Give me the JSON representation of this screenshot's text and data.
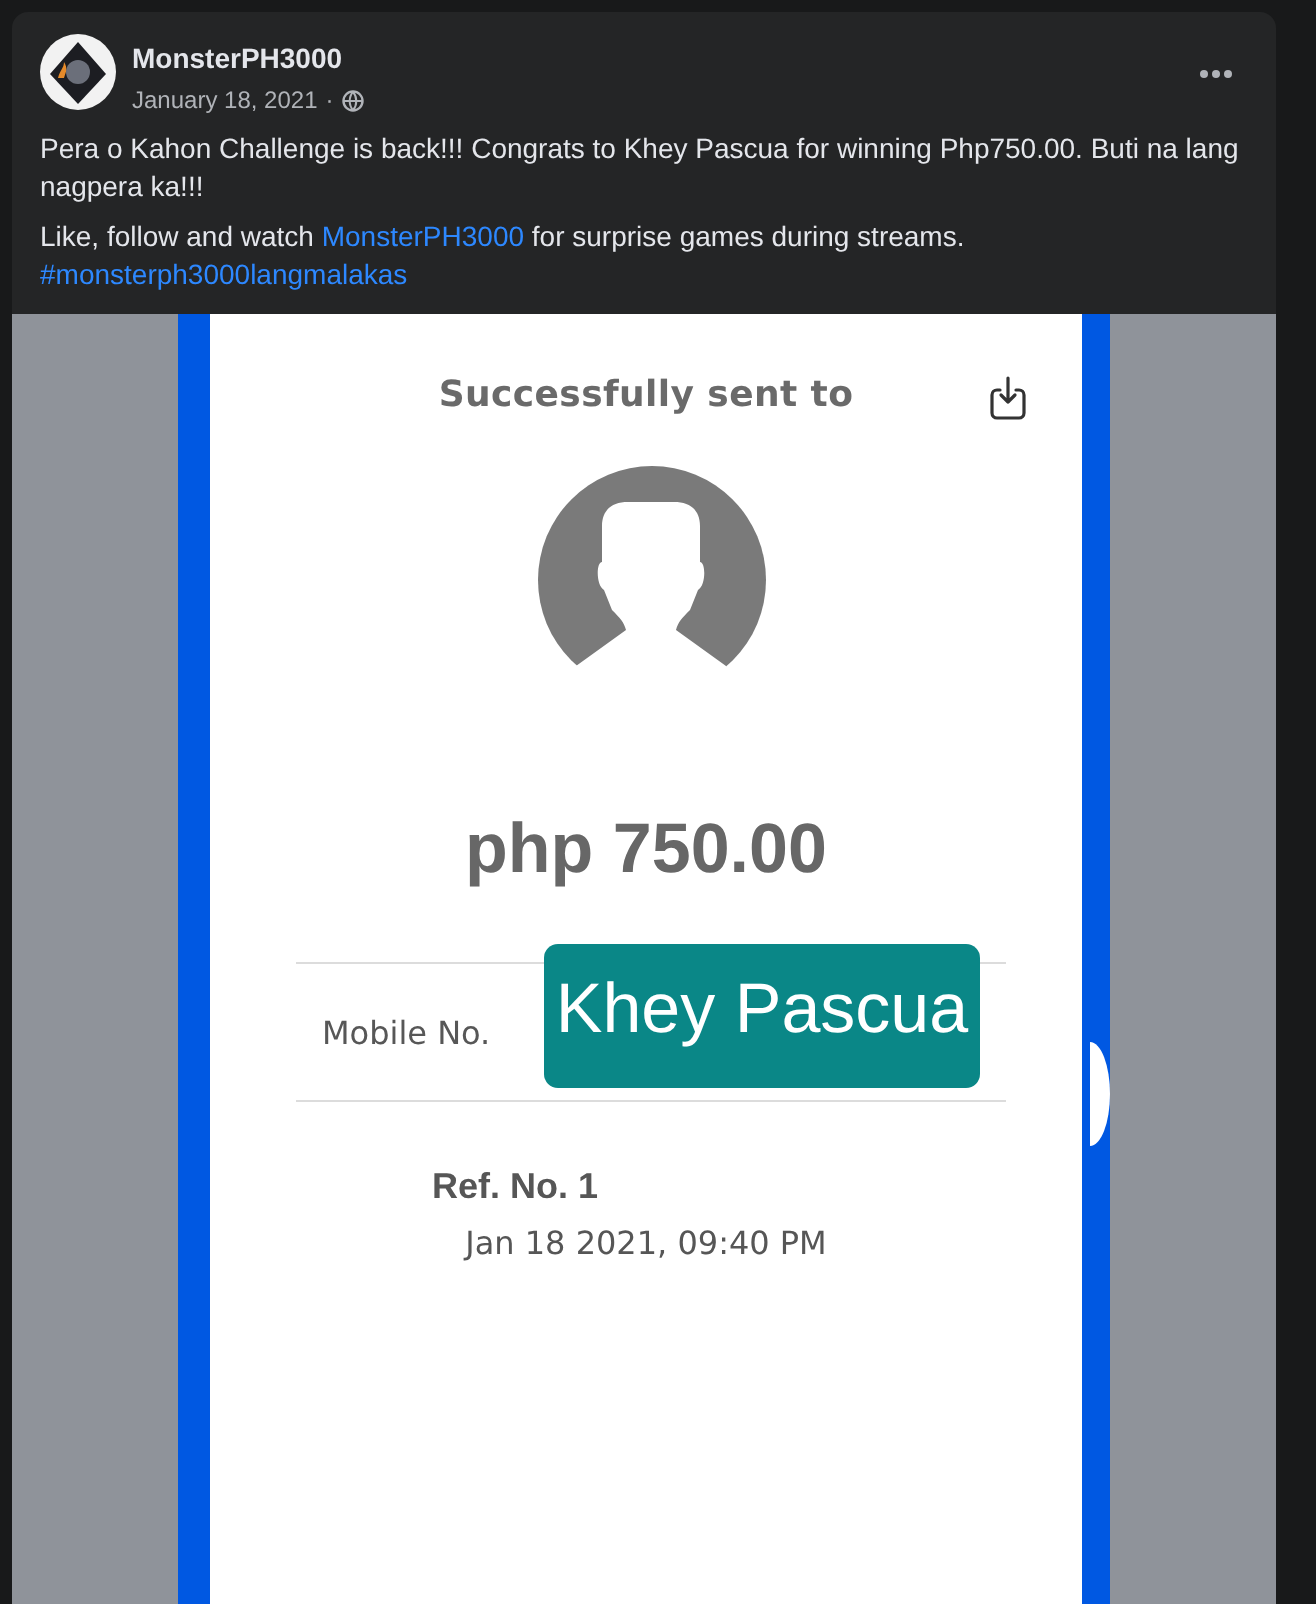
{
  "post": {
    "author": "MonsterPH3000",
    "date": "January 18, 2021",
    "separator": "·",
    "paragraphs": [
      {
        "segments": [
          {
            "kind": "text",
            "text": "Pera o Kahon Challenge is back!!! Congrats to Khey Pascua for winning Php750.00. Buti na lang nagpera ka!!!"
          }
        ]
      },
      {
        "segments": [
          {
            "kind": "text",
            "text": "Like, follow and watch "
          },
          {
            "kind": "link",
            "text": "MonsterPH3000"
          },
          {
            "kind": "text",
            "text": " for surprise games during streams. "
          },
          {
            "kind": "hashtag",
            "text": "#monsterph3000langmalakas"
          }
        ]
      }
    ]
  },
  "receipt": {
    "title": "Successfully sent to",
    "amount": "php 750.00",
    "fields": [
      {
        "label": "Mobile No.",
        "sticker": "Khey Pascua"
      }
    ],
    "reference": "Ref. No. 1",
    "datetime": "Jan 18 2021, 09:40 PM"
  }
}
